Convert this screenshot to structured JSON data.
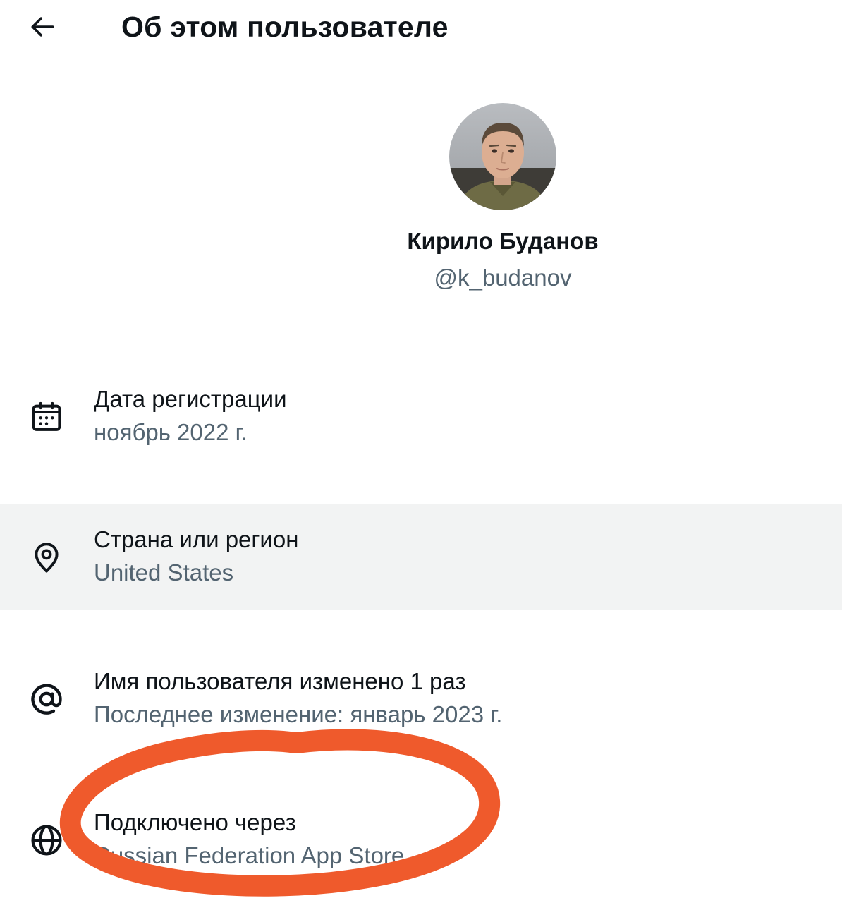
{
  "header": {
    "title": "Об этом пользователе",
    "back_icon": "arrow-left-icon"
  },
  "profile": {
    "display_name": "Кирило Буданов",
    "handle": "@k_budanov",
    "avatar": "profile-photo"
  },
  "details": [
    {
      "icon": "calendar-icon",
      "label": "Дата регистрации",
      "value": "ноябрь 2022 г."
    },
    {
      "icon": "location-pin-icon",
      "label": "Страна или регион",
      "value": "United States"
    },
    {
      "icon": "at-sign-icon",
      "label": "Имя пользователя изменено 1 раз",
      "value": "Последнее изменение: январь 2023 г."
    },
    {
      "icon": "globe-icon",
      "label": "Подключено через",
      "value": "Russian Federation App Store"
    }
  ],
  "colors": {
    "text_primary": "#0f1419",
    "text_secondary": "#536471",
    "highlight_row": "#f2f3f3",
    "annotation_circle": "#ef5a2c"
  }
}
